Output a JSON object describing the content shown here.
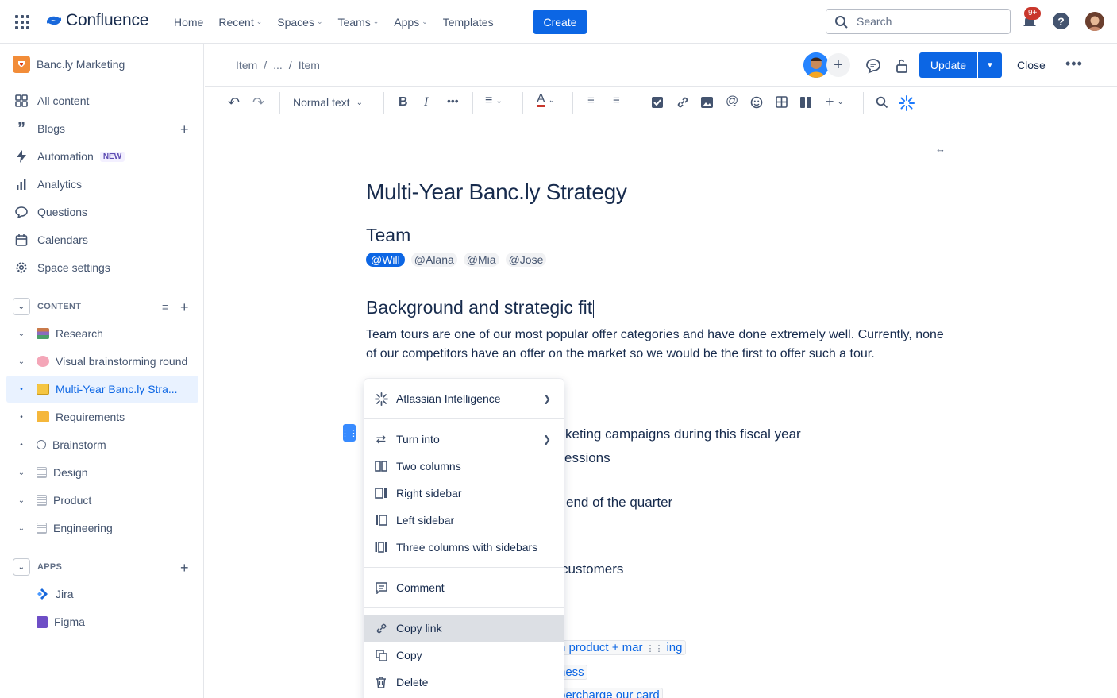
{
  "brand": {
    "name": "Confluence",
    "accent": "#0c66e4"
  },
  "topnav": {
    "items": [
      {
        "label": "Home",
        "dropdown": false
      },
      {
        "label": "Recent",
        "dropdown": true
      },
      {
        "label": "Spaces",
        "dropdown": true
      },
      {
        "label": "Teams",
        "dropdown": true
      },
      {
        "label": "Apps",
        "dropdown": true
      },
      {
        "label": "Templates",
        "dropdown": false
      }
    ],
    "create_label": "Create",
    "search_placeholder": "Search",
    "notif_badge": "9+"
  },
  "sidebar": {
    "space_name": "Banc.ly Marketing",
    "items": [
      {
        "label": "All content",
        "icon": "grid-icon"
      },
      {
        "label": "Blogs",
        "icon": "quote-icon"
      },
      {
        "label": "Automation",
        "icon": "bolt-icon",
        "lozenge": "NEW"
      },
      {
        "label": "Analytics",
        "icon": "bar-chart-icon"
      },
      {
        "label": "Questions",
        "icon": "speech-bubble-icon"
      },
      {
        "label": "Calendars",
        "icon": "calendar-icon"
      },
      {
        "label": "Space settings",
        "icon": "gear-icon"
      }
    ],
    "content_header": "CONTENT",
    "tree": [
      {
        "label": "Research",
        "toggle": "chevron",
        "selected": false
      },
      {
        "label": "Visual brainstorming round",
        "toggle": "chevron",
        "selected": false
      },
      {
        "label": "Multi-Year Banc.ly Stra...",
        "toggle": "dot",
        "selected": true
      },
      {
        "label": "Requirements",
        "toggle": "dot",
        "selected": false
      },
      {
        "label": "Brainstorm",
        "toggle": "dot",
        "selected": false
      },
      {
        "label": "Design",
        "toggle": "chevron",
        "selected": false
      },
      {
        "label": "Product",
        "toggle": "chevron",
        "selected": false
      },
      {
        "label": "Engineering",
        "toggle": "chevron",
        "selected": false
      }
    ],
    "apps_header": "APPS",
    "apps": [
      {
        "label": "Jira",
        "icon": "jira-icon"
      },
      {
        "label": "Figma",
        "icon": "figma-icon"
      }
    ]
  },
  "editor": {
    "breadcrumb": [
      "Item",
      "...",
      "Item"
    ],
    "update_label": "Update",
    "close_label": "Close",
    "text_style": "Normal text"
  },
  "page": {
    "title": "Multi-Year Banc.ly Strategy",
    "team_heading": "Team",
    "mentions": [
      "@Will",
      "@Alana",
      "@Mia",
      "@Jose"
    ],
    "bg_heading": "Background and strategic fit",
    "paragraph": "Team tours are one of our most popular offer categories and have done extremely well. Currently, none of our competitors have an offer on the market so we would be the first to offer such a tour.",
    "fragments": {
      "f1": "keting campaigns during this fiscal year",
      "f2": "essions",
      "f3": "end of the quarter",
      "f4": "customers",
      "l1": "n product + mar",
      "l1b": "ing",
      "l2": "ness",
      "l3": "percharge our card"
    }
  },
  "context_menu": {
    "ai": "Atlassian Intelligence",
    "turn_into": "Turn into",
    "two_columns": "Two columns",
    "right_sidebar": "Right sidebar",
    "left_sidebar": "Left sidebar",
    "three_columns": "Three columns with sidebars",
    "comment": "Comment",
    "copy_link": "Copy link",
    "copy": "Copy",
    "delete": "Delete"
  }
}
